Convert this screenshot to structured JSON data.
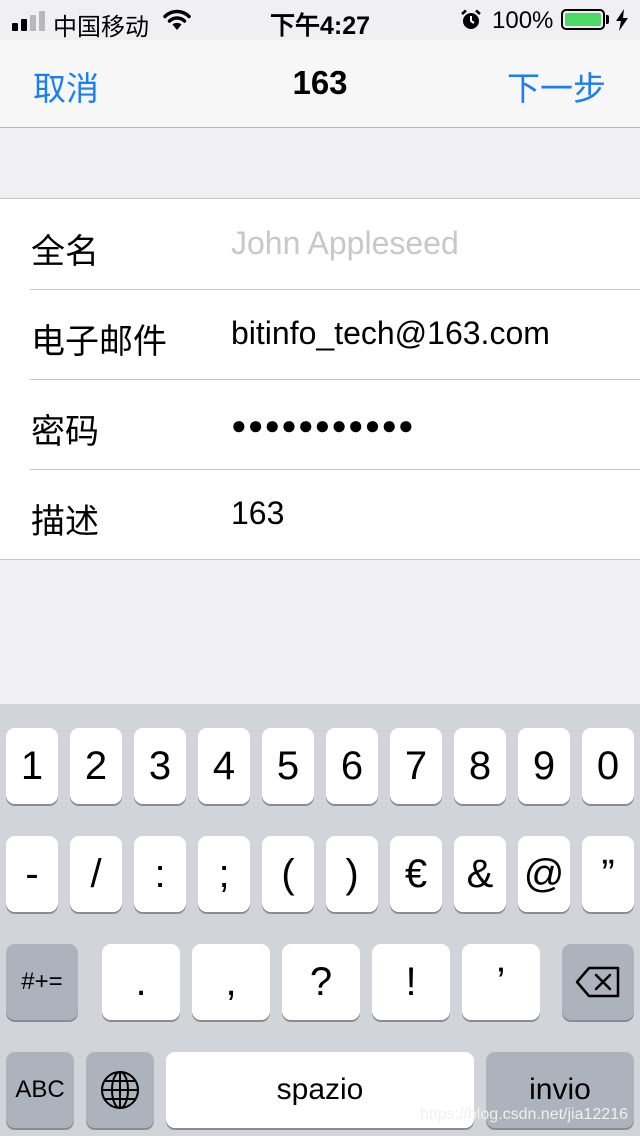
{
  "status_bar": {
    "carrier": "中国移动",
    "time": "下午4:27",
    "battery_percent": "100%",
    "battery_level": 1.0,
    "signal_bars": 4,
    "signal_bars_filled": 2,
    "battery_color": "#4cd964"
  },
  "nav": {
    "cancel_label": "取消",
    "title": "163",
    "next_label": "下一步",
    "accent_color": "#1a7ef5"
  },
  "form": {
    "rows": [
      {
        "label": "全名",
        "value": "",
        "placeholder": "John Appleseed"
      },
      {
        "label": "电子邮件",
        "value": "bitinfo_tech@163.com"
      },
      {
        "label": "密码",
        "value": "●●●●●●●●●●●"
      },
      {
        "label": "描述",
        "value": "163"
      }
    ]
  },
  "keyboard": {
    "row1": [
      "1",
      "2",
      "3",
      "4",
      "5",
      "6",
      "7",
      "8",
      "9",
      "0"
    ],
    "row2": [
      "-",
      "/",
      ":",
      ";",
      "(",
      ")",
      "€",
      "&",
      "@",
      "”"
    ],
    "row3": [
      ".",
      ",",
      "?",
      "!",
      "’"
    ],
    "symbols_label": "#+=",
    "abc_label": "ABC",
    "space_label": "spazio",
    "return_label": "invio",
    "icons": [
      "backspace-icon",
      "globe-icon"
    ]
  },
  "watermark": "https://blog.csdn.net/jia12216"
}
